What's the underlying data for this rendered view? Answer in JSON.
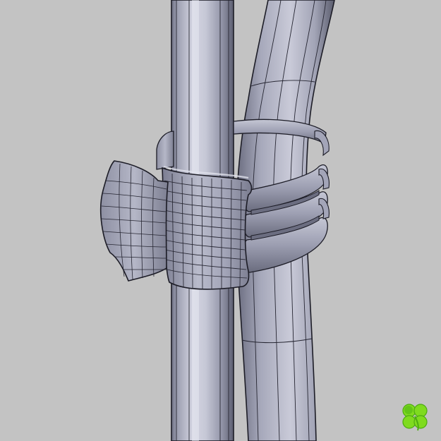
{
  "viewport": {
    "background_color": "#c3c3c3"
  },
  "model": {
    "parts": [
      "straight-pipe",
      "curved-hose",
      "pipe-clamp"
    ],
    "display_mode": "shaded-with-mesh-edges",
    "shade_colors": {
      "highlight": "#d9dae6",
      "mid": "#a8aabb",
      "shadow": "#5e6072",
      "edge_line": "#1a1a24"
    }
  },
  "logo": {
    "icon": "four-leaf-clover-icon",
    "colors": [
      "#7fdb1f",
      "#4caa12"
    ]
  }
}
